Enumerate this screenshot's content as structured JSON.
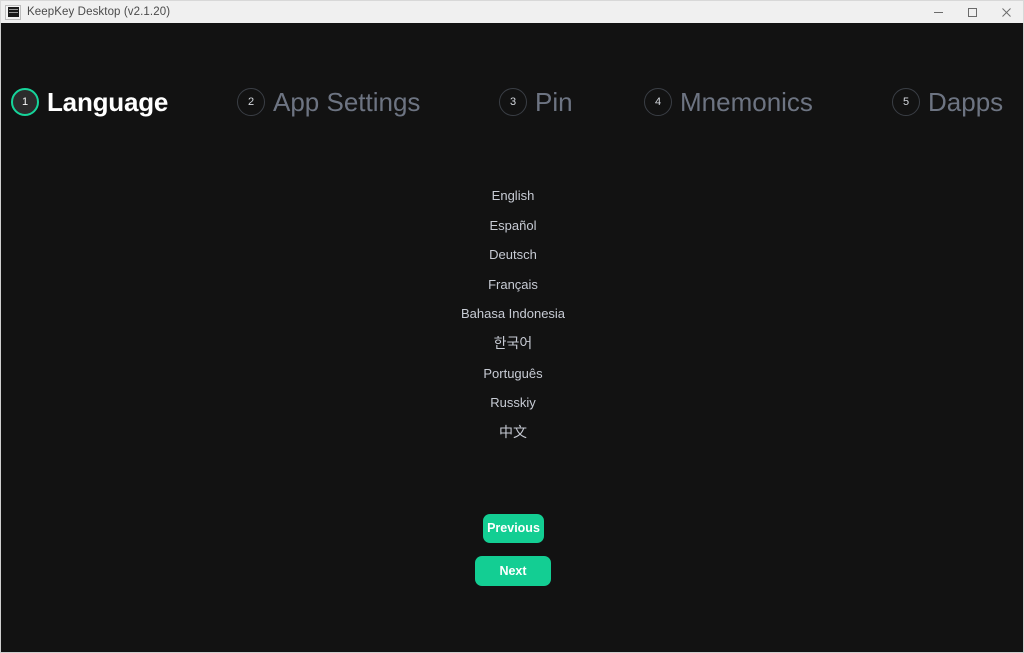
{
  "titlebar": {
    "app_icon": "keepkey-app-icon",
    "title": "KeepKey Desktop (v2.1.20)",
    "minimize_label": "minimize-icon",
    "maximize_label": "maximize-icon",
    "close_label": "close-icon"
  },
  "colors": {
    "accent": "#13ce93",
    "active_ring": "#16d49a",
    "window_bg": "#121212",
    "titlebar_bg": "#f0f0f0",
    "step_active_text": "#ffffff",
    "step_idle_text": "#6d7482",
    "list_text": "#c7cbd4"
  },
  "stepper": {
    "active_step": 1,
    "steps": [
      {
        "number": "1",
        "label": "Language",
        "state": "active"
      },
      {
        "number": "2",
        "label": "App Settings",
        "state": "idle"
      },
      {
        "number": "3",
        "label": "Pin",
        "state": "idle"
      },
      {
        "number": "4",
        "label": "Mnemonics",
        "state": "idle"
      },
      {
        "number": "5",
        "label": "Dapps",
        "state": "idle"
      }
    ]
  },
  "language_list": {
    "items": [
      {
        "label": "English"
      },
      {
        "label": "Español"
      },
      {
        "label": "Deutsch"
      },
      {
        "label": "Français"
      },
      {
        "label": "Bahasa Indonesia"
      },
      {
        "label": "한국어"
      },
      {
        "label": "Português"
      },
      {
        "label": "Russkiy"
      },
      {
        "label": "中文"
      }
    ]
  },
  "navigation": {
    "previous_label": "Previous",
    "next_label": "Next"
  }
}
